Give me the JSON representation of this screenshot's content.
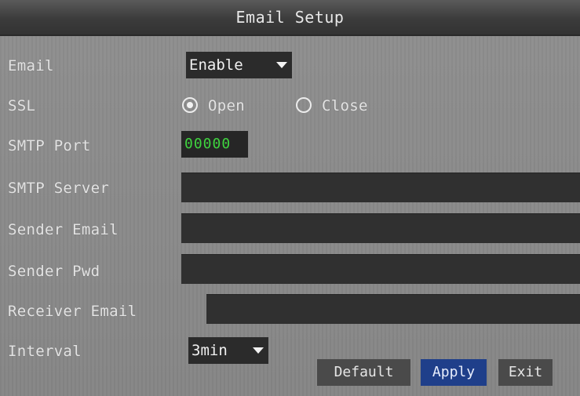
{
  "window": {
    "title": "Email Setup"
  },
  "email": {
    "label": "Email",
    "value": "Enable"
  },
  "ssl": {
    "label": "SSL",
    "options": [
      {
        "label": "Open",
        "selected": true
      },
      {
        "label": "Close",
        "selected": false
      }
    ]
  },
  "smtp_port": {
    "label": "SMTP Port",
    "value": "00000"
  },
  "smtp_server": {
    "label": "SMTP Server",
    "value": ""
  },
  "sender_email": {
    "label": "Sender Email",
    "value": ""
  },
  "sender_pwd": {
    "label": "Sender Pwd",
    "value": ""
  },
  "receiver_email": {
    "label": "Receiver Email",
    "value": ""
  },
  "interval": {
    "label": "Interval",
    "value": "3min"
  },
  "buttons": {
    "default": "Default",
    "apply": "Apply",
    "exit": "Exit"
  },
  "colors": {
    "accent": "#1f3f8a",
    "port_text": "#3fd43f"
  }
}
